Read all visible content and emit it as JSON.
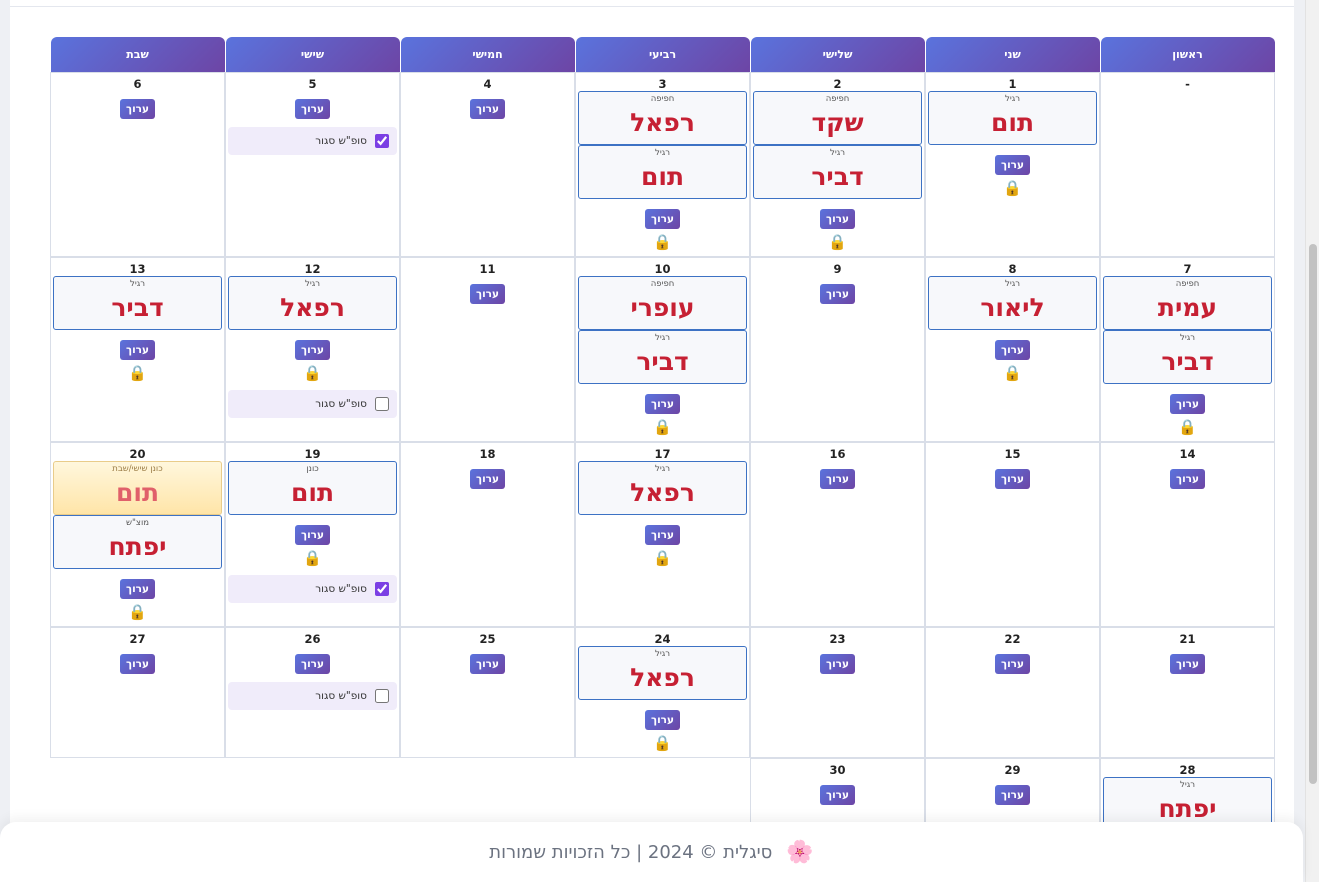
{
  "calendar": {
    "weekdays": [
      "ראשון",
      "שני",
      "שלישי",
      "רביעי",
      "חמישי",
      "שישי",
      "שבת"
    ],
    "edit_label": "ערוך",
    "weekend_label": "סופ\"ש סגור",
    "weeks": [
      [
        {
          "day": "-",
          "shifts": [],
          "edit": false,
          "lock": false
        },
        {
          "day": "1",
          "shifts": [
            {
              "type": "רגיל",
              "name": "תום"
            }
          ],
          "edit": true,
          "lock": true
        },
        {
          "day": "2",
          "shifts": [
            {
              "type": "חפיפה",
              "name": "שקד"
            },
            {
              "type": "רגיל",
              "name": "דביר"
            }
          ],
          "edit": true,
          "lock": true
        },
        {
          "day": "3",
          "shifts": [
            {
              "type": "חפיפה",
              "name": "רפאל"
            },
            {
              "type": "רגיל",
              "name": "תום"
            }
          ],
          "edit": true,
          "lock": true
        },
        {
          "day": "4",
          "shifts": [],
          "edit": true,
          "lock": false
        },
        {
          "day": "5",
          "shifts": [],
          "edit": true,
          "lock": false,
          "weekend": true,
          "weekend_checked": true
        },
        {
          "day": "6",
          "shifts": [],
          "edit": true,
          "lock": false
        }
      ],
      [
        {
          "day": "7",
          "shifts": [
            {
              "type": "חפיפה",
              "name": "עמית"
            },
            {
              "type": "רגיל",
              "name": "דביר"
            }
          ],
          "edit": true,
          "lock": true
        },
        {
          "day": "8",
          "shifts": [
            {
              "type": "רגיל",
              "name": "ליאור"
            }
          ],
          "edit": true,
          "lock": true
        },
        {
          "day": "9",
          "shifts": [],
          "edit": true,
          "lock": false
        },
        {
          "day": "10",
          "shifts": [
            {
              "type": "חפיפה",
              "name": "עופרי"
            },
            {
              "type": "רגיל",
              "name": "דביר"
            }
          ],
          "edit": true,
          "lock": true
        },
        {
          "day": "11",
          "shifts": [],
          "edit": true,
          "lock": false
        },
        {
          "day": "12",
          "shifts": [
            {
              "type": "רגיל",
              "name": "רפאל"
            }
          ],
          "edit": true,
          "lock": true,
          "weekend": true,
          "weekend_checked": false
        },
        {
          "day": "13",
          "shifts": [
            {
              "type": "רגיל",
              "name": "דביר"
            }
          ],
          "edit": true,
          "lock": true
        }
      ],
      [
        {
          "day": "14",
          "shifts": [],
          "edit": true,
          "lock": false
        },
        {
          "day": "15",
          "shifts": [],
          "edit": true,
          "lock": false
        },
        {
          "day": "16",
          "shifts": [],
          "edit": true,
          "lock": false
        },
        {
          "day": "17",
          "shifts": [
            {
              "type": "רגיל",
              "name": "רפאל"
            }
          ],
          "edit": true,
          "lock": true
        },
        {
          "day": "18",
          "shifts": [],
          "edit": true,
          "lock": false
        },
        {
          "day": "19",
          "shifts": [
            {
              "type": "כונן",
              "name": "תום"
            }
          ],
          "edit": true,
          "lock": true,
          "weekend": true,
          "weekend_checked": true
        },
        {
          "day": "20",
          "shifts": [
            {
              "type": "כונן שישי/שבת",
              "name": "תום",
              "special": true
            },
            {
              "type": "מוצ\"ש",
              "name": "יפתח"
            }
          ],
          "edit": true,
          "lock": true
        }
      ],
      [
        {
          "day": "21",
          "shifts": [],
          "edit": true,
          "lock": false
        },
        {
          "day": "22",
          "shifts": [],
          "edit": true,
          "lock": false
        },
        {
          "day": "23",
          "shifts": [],
          "edit": true,
          "lock": false
        },
        {
          "day": "24",
          "shifts": [
            {
              "type": "רגיל",
              "name": "רפאל"
            }
          ],
          "edit": true,
          "lock": true
        },
        {
          "day": "25",
          "shifts": [],
          "edit": true,
          "lock": false
        },
        {
          "day": "26",
          "shifts": [],
          "edit": true,
          "lock": false,
          "weekend": true,
          "weekend_checked": false
        },
        {
          "day": "27",
          "shifts": [],
          "edit": true,
          "lock": false
        }
      ],
      [
        {
          "day": "28",
          "shifts": [
            {
              "type": "רגיל",
              "name": "יפתח"
            }
          ],
          "edit": false,
          "lock": false
        },
        {
          "day": "29",
          "shifts": [],
          "edit": true,
          "lock": false
        },
        {
          "day": "30",
          "shifts": [],
          "edit": true,
          "lock": false
        },
        null,
        null,
        null,
        null
      ]
    ]
  },
  "footer": {
    "text": "סיגלית © 2024 | כל הזכויות שמורות",
    "icon": "flower-icon",
    "icon_glyph": "🌸"
  },
  "colors": {
    "header_gradient_start": "#5a73dd",
    "header_gradient_end": "#6d45a5",
    "shift_name": "#c62033",
    "shift_border": "#3d72c4",
    "weekend_bg": "#f0ecfa"
  }
}
